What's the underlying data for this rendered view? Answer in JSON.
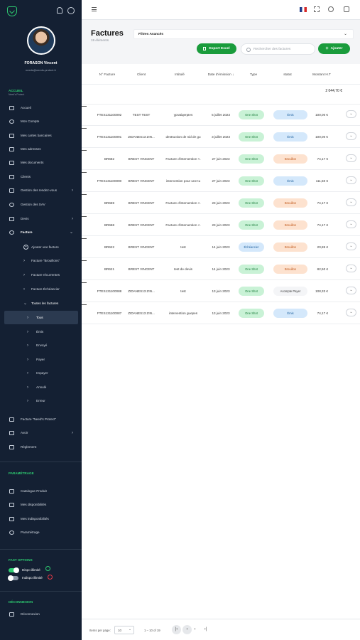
{
  "user": {
    "name": "FORASON Vincent",
    "email": "needs@needs-protect.fr"
  },
  "menu": {
    "section_access": "ACCUEIL",
    "section_access_sub": "Need's Protect",
    "items": [
      "Accueil",
      "Mon Compte",
      "Mes cartes bancaires",
      "Mes adresses",
      "Mes documents",
      "Clients",
      "Gestion des rendez-vous",
      "Gestion des SAV",
      "Devis",
      "Facture"
    ],
    "facture_sub": [
      "Ajouter une facture",
      "Facture \"Brouillons\"",
      "Facture récurrentes",
      "Facture Échéancier",
      "Toutes les factures"
    ],
    "toutes_sub": [
      "Tous",
      "Émis",
      "Envoyé",
      "Payer",
      "Impayer",
      "Annulé",
      "Erreur"
    ],
    "after": [
      "Facture \"Need's Protect\"",
      "Avoir",
      "Règlement"
    ],
    "section_param": "PARAMÉTRAGE",
    "param_items": [
      "Catalogue Produit",
      "Mes disponibilités",
      "Mes indisponibilités",
      "Paramétrage"
    ],
    "section_fast": "FAST OPTIONS",
    "dispo": "Dispo illimité",
    "indispo": "Indispo illimité",
    "section_deco": "DÉCONNEXION",
    "deco": "Déconnexion"
  },
  "page": {
    "title": "Factures",
    "count": "19 éléments",
    "filters": "Filtres Avancés",
    "export": "Export Excel",
    "search_placeholder": "Rechercher des factures",
    "add": "Ajouter"
  },
  "columns": [
    "N° Facture",
    "Client",
    "Intitulé",
    "Date d'émission",
    "Type",
    "statut",
    "Montant H.T"
  ],
  "total": "2 044,70 €",
  "rows": [
    [
      "FTES131100092",
      "TEST TEST",
      "ypratiqerpIes",
      "5 juillet 2023",
      "One Shot",
      "Émis",
      "100,00 €"
    ],
    [
      "FTES131100091",
      "ZIDANES13 ZIN...",
      "destruction de nid de gu",
      "3 juillet 2023",
      "One Shot",
      "Émis",
      "100,00 €"
    ],
    [
      "BR682",
      "BREST VINCENT",
      "Facture d'intervention <.",
      "27 juin 2023",
      "One Shot",
      "Brouillon",
      "74,17 €"
    ],
    [
      "FTES131100090",
      "BREST VINCENT",
      "intervention pour une tu",
      "27 juin 2023",
      "One Shot",
      "Émis",
      "111,50 €"
    ],
    [
      "BR659",
      "BREST VINCENT",
      "Facture d'intervention <.",
      "23 juin 2023",
      "One Shot",
      "Brouillon",
      "74,17 €"
    ],
    [
      "BR658",
      "BREST VINCENT",
      "Facture d'intervention <.",
      "23 juin 2023",
      "One Shot",
      "Brouillon",
      "74,17 €"
    ],
    [
      "BR622",
      "BREST VINCENT",
      "test",
      "14 juin 2023",
      "Échéancier",
      "Brouillon",
      "20,85 €"
    ],
    [
      "BR621",
      "BREST VINCENT",
      "test de devis",
      "14 juin 2023",
      "One Shot",
      "Brouillon",
      "82,50 €"
    ],
    [
      "FTES131100088",
      "ZIDANES13 ZIN...",
      "test",
      "13 juin 2023",
      "One Shot",
      "Acompte Payer",
      "108,33 €"
    ],
    [
      "FTES131100087",
      "ZIDANES13 ZIN...",
      "intervention guepes",
      "13 juin 2023",
      "One Shot",
      "Émis",
      "74,17 €"
    ]
  ],
  "footer": {
    "items_per_page": "Items per page:",
    "per_page_value": "10",
    "range": "1 – 10 of 19"
  },
  "colors": {
    "sidebar": "#142033",
    "green": "#1a9c3c",
    "accent": "#2ecc71"
  }
}
